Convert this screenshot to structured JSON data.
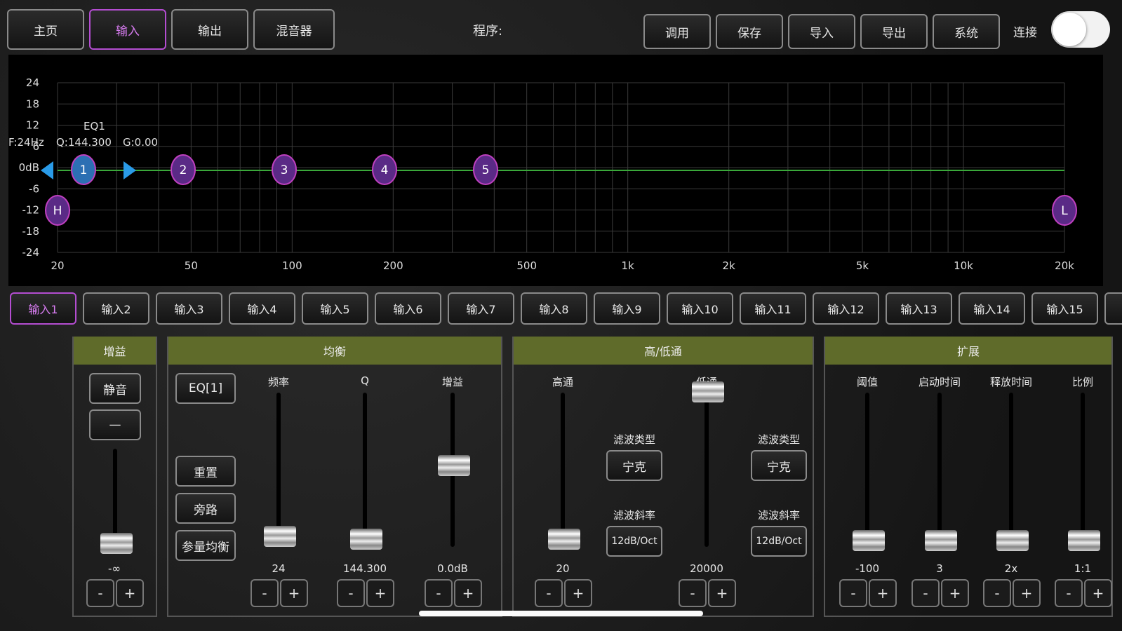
{
  "top_nav": {
    "home": "主页",
    "input": "输入",
    "output": "输出",
    "mixer": "混音器"
  },
  "program_label": "程序:",
  "top_actions": {
    "recall": "调用",
    "save": "保存",
    "import": "导入",
    "export": "导出",
    "system": "系统"
  },
  "link_label": "连接",
  "link_enabled": true,
  "eq_graph": {
    "y_ticks": [
      "24",
      "18",
      "12",
      "6",
      "0dB",
      "-6",
      "-12",
      "-18",
      "-24"
    ],
    "x_ticks": [
      "20",
      "50",
      "100",
      "200",
      "500",
      "1k",
      "2k",
      "5k",
      "10k",
      "20k"
    ],
    "info_title": "EQ1",
    "info_freq": "F:24Hz",
    "info_q": "Q:144.300",
    "info_gain": "G:0.00",
    "bands": [
      "1",
      "2",
      "3",
      "4",
      "5"
    ],
    "hp_label": "H",
    "lp_label": "L",
    "curve_color": "#3aa83a"
  },
  "channel_tabs": [
    "输入1",
    "输入2",
    "输入3",
    "输入4",
    "输入5",
    "输入6",
    "输入7",
    "输入8",
    "输入9",
    "输入10",
    "输入11",
    "输入12",
    "输入13",
    "输入14",
    "输入15"
  ],
  "gain_panel": {
    "title": "增益",
    "mute": "静音",
    "phase": "—",
    "value": "-∞",
    "level": 0.0
  },
  "eq_panel": {
    "title": "均衡",
    "band_button": "EQ[1]",
    "reset": "重置",
    "bypass": "旁路",
    "param_eq": "参量均衡",
    "freq_label": "频率",
    "q_label": "Q",
    "gain_label": "增益",
    "freq_value": "24",
    "q_value": "144.300",
    "gain_value": "0.0dB",
    "freq_level": 0.02,
    "q_level": 0.0,
    "gain_level": 0.5
  },
  "filter_panel": {
    "title": "高/低通",
    "hp_label": "高通",
    "lp_label": "低通",
    "filter_type_label": "滤波类型",
    "slope_label": "滤波斜率",
    "hp_type": "宁克",
    "lp_type": "宁克",
    "hp_slope": "12dB/Oct",
    "lp_slope": "12dB/Oct",
    "hp_value": "20",
    "lp_value": "20000",
    "hp_level": 0.0,
    "lp_level": 1.0
  },
  "expander_panel": {
    "title": "扩展",
    "threshold_label": "阈值",
    "attack_label": "启动时间",
    "release_label": "释放时间",
    "ratio_label": "比例",
    "threshold_value": "-100",
    "attack_value": "3",
    "release_value": "2x",
    "ratio_value": "1:1"
  },
  "stepper": {
    "minus": "-",
    "plus": "+"
  }
}
